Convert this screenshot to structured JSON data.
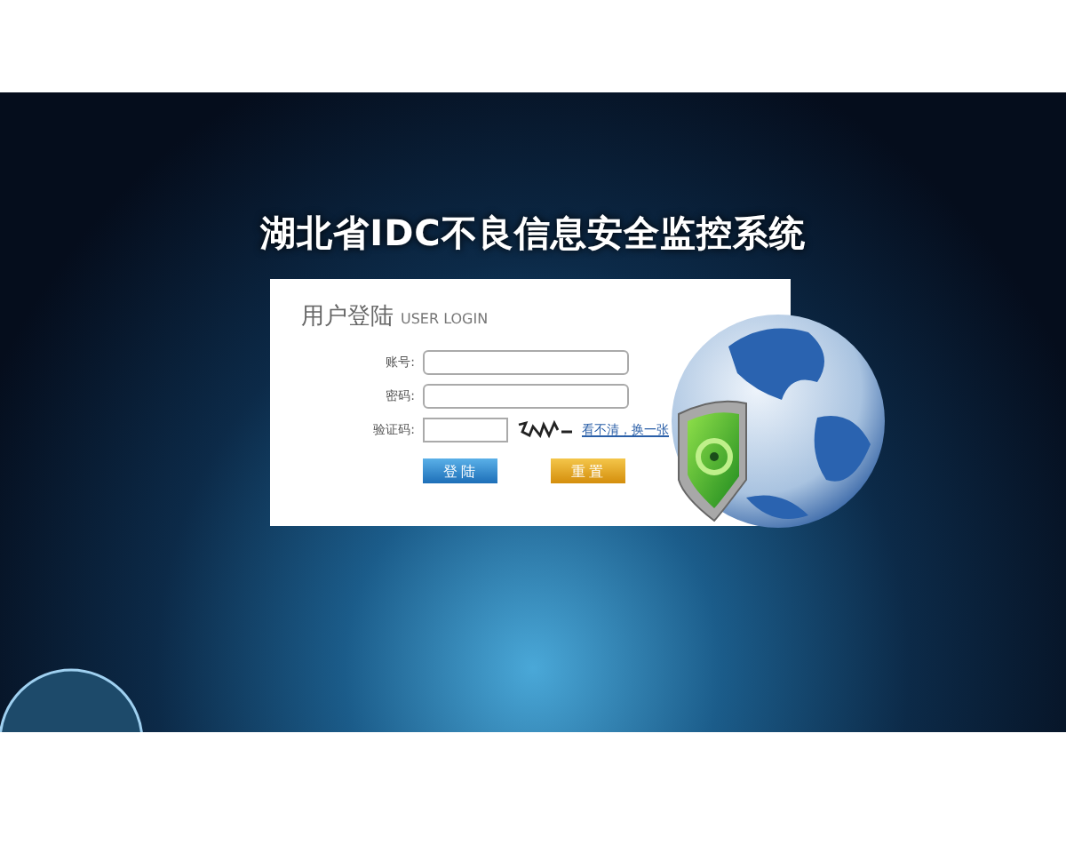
{
  "title": "湖北省IDC不良信息安全监控系统",
  "login": {
    "heading": "用户登陆",
    "subheading": "USER LOGIN",
    "fields": [
      {
        "kind": "text",
        "label": "账号:"
      },
      {
        "kind": "password",
        "label": "密码:"
      },
      {
        "kind": "captcha",
        "label": "验证码:",
        "link": "看不清，换一张"
      }
    ],
    "buttons": [
      {
        "kind": "primary",
        "label": "登 陆"
      },
      {
        "kind": "secondary",
        "label": "重 置"
      }
    ]
  }
}
